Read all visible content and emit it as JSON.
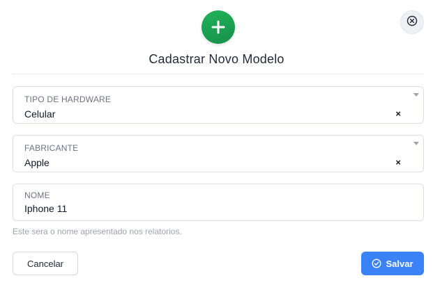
{
  "modal": {
    "title": "Cadastrar Novo Modelo",
    "header_icon": "plus-icon",
    "close_icon": "close-circle-icon"
  },
  "fields": {
    "hardware_type": {
      "label": "TIPO DE HARDWARE",
      "value": "Celular",
      "clear": "×"
    },
    "manufacturer": {
      "label": "FABRICANTE",
      "value": "Apple",
      "clear": "×"
    },
    "name": {
      "label": "NOME",
      "value": "Iphone 11"
    }
  },
  "hint": "Este sera o nome apresentado nos relatorios.",
  "actions": {
    "cancel_label": "Cancelar",
    "save_label": "Salvar",
    "save_icon": "check-circle-icon"
  },
  "colors": {
    "brand_green": "#1fa653",
    "primary_blue": "#3b82f6"
  }
}
